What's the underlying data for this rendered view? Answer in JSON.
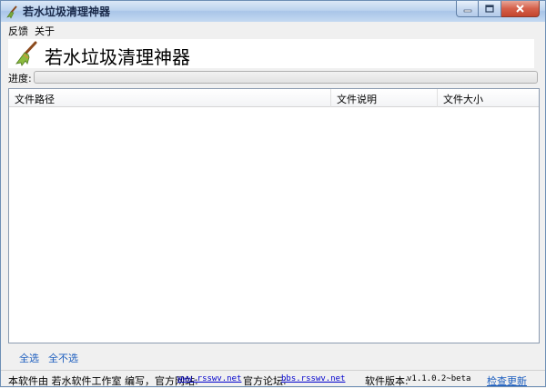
{
  "window": {
    "title": "若水垃圾清理神器",
    "buttons": {
      "minimize": "minimize-icon",
      "maximize": "maximize-icon",
      "close": "close-icon"
    }
  },
  "menu": {
    "items": [
      {
        "label": "反馈"
      },
      {
        "label": "关于"
      }
    ]
  },
  "banner": {
    "icon": "broom-icon",
    "title": "若水垃圾清理神器"
  },
  "progress": {
    "label": "进度:",
    "value": 0
  },
  "list": {
    "columns": [
      {
        "label": "文件路径"
      },
      {
        "label": "文件说明"
      },
      {
        "label": "文件大小"
      }
    ],
    "rows": []
  },
  "actions": {
    "select_all": "全选",
    "select_none": "全不选"
  },
  "status": {
    "made_by": "本软件由 若水软件工作室 编写，官方网站:",
    "website": "www.rsswv.net",
    "forum_label": "官方论坛:",
    "forum": "bbs.rsswv.net",
    "version_label": "软件版本:",
    "version": "v1.1.0.2~beta",
    "check_update": "检查更新"
  },
  "colors": {
    "title_bar": "#bcd3ee",
    "link": "#1e5fbf",
    "progress_fill": "#37b12e",
    "close_button": "#d5604a"
  }
}
